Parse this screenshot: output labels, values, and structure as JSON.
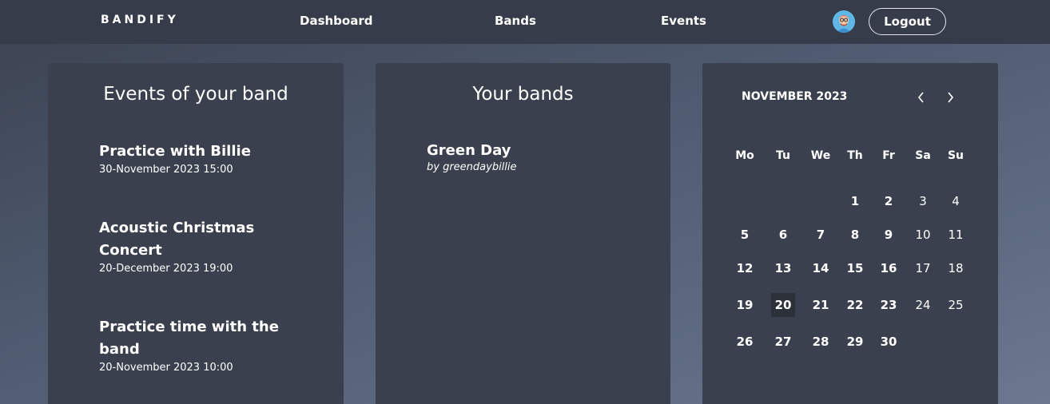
{
  "nav": {
    "brand": "BANDIFY",
    "links": [
      "Dashboard",
      "Bands",
      "Events"
    ],
    "logout": "Logout"
  },
  "events_card": {
    "title": "Events of your band",
    "events": [
      {
        "title_line1": "Practice with Billie",
        "title_line2": "",
        "date": "30-November 2023 15:00"
      },
      {
        "title_line1": "Acoustic Christmas",
        "title_line2": "Concert",
        "date": "20-December 2023 19:00"
      },
      {
        "title_line1": "Practice time with the",
        "title_line2": "band",
        "date": "20-November 2023 10:00"
      }
    ]
  },
  "bands_card": {
    "title": "Your bands",
    "bands": [
      {
        "name": "Green Day",
        "owner": "by greendaybillie"
      }
    ]
  },
  "calendar": {
    "month_label": "NOVEMBER 2023",
    "weekdays": [
      "Mo",
      "Tu",
      "We",
      "Th",
      "Fr",
      "Sa",
      "Su"
    ],
    "weeks": [
      [
        "",
        "",
        "",
        "1",
        "2",
        "3",
        "4"
      ],
      [
        "5",
        "6",
        "7",
        "8",
        "9",
        "10",
        "11"
      ],
      [
        "12",
        "13",
        "14",
        "15",
        "16",
        "17",
        "18"
      ],
      [
        "19",
        "20",
        "21",
        "22",
        "23",
        "24",
        "25"
      ],
      [
        "26",
        "27",
        "28",
        "29",
        "30",
        "",
        ""
      ]
    ],
    "selected_day": "20"
  },
  "colors": {
    "navbar": "#363c49",
    "card": "#3a404d",
    "selected_day_bg": "#2b3039"
  },
  "icons": {
    "prev": "chevron-left-icon",
    "next": "chevron-right-icon",
    "avatar": "user-avatar-icon"
  }
}
